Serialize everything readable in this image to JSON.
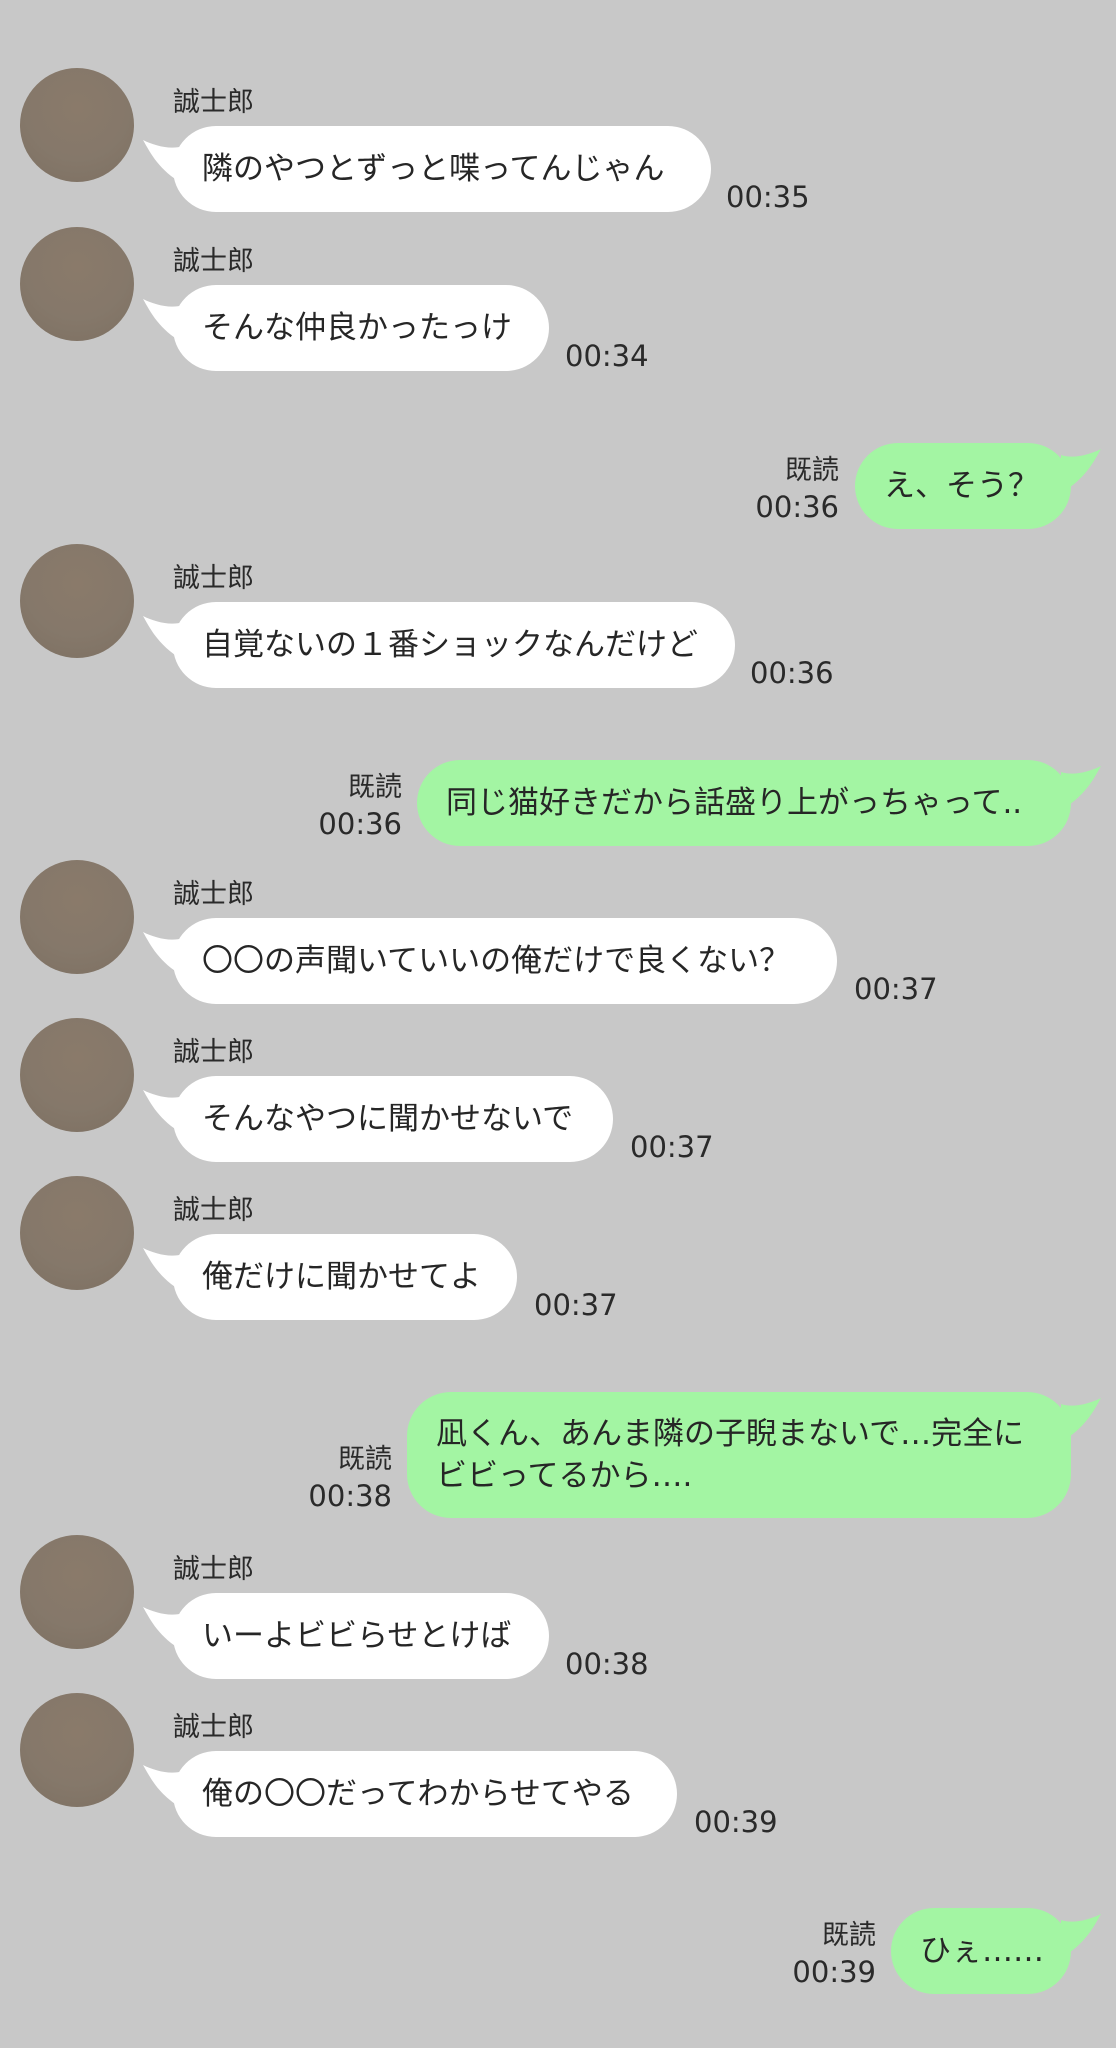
{
  "chat": {
    "read_label": "既読",
    "colors": {
      "background": "#c8c8c8",
      "incoming_bubble": "#ffffff",
      "outgoing_bubble": "#a3f5a3"
    },
    "messages": [
      {
        "direction": "in",
        "sender": "誠士郎",
        "text": "隣のやつとずっと喋ってんじゃん",
        "time": "00:35"
      },
      {
        "direction": "in",
        "sender": "誠士郎",
        "text": "そんな仲良かったっけ",
        "time": "00:34"
      },
      {
        "direction": "out",
        "status": "既読",
        "text": "え、そう？",
        "time": "00:36"
      },
      {
        "direction": "in",
        "sender": "誠士郎",
        "text": "自覚ないの１番ショックなんだけど",
        "time": "00:36"
      },
      {
        "direction": "out",
        "status": "既読",
        "text": "同じ猫好きだから話盛り上がっちゃって..",
        "time": "00:36"
      },
      {
        "direction": "in",
        "sender": "誠士郎",
        "text": "〇〇の声聞いていいの俺だけで良くない？",
        "time": "00:37"
      },
      {
        "direction": "in",
        "sender": "誠士郎",
        "text": "そんなやつに聞かせないで",
        "time": "00:37"
      },
      {
        "direction": "in",
        "sender": "誠士郎",
        "text": "俺だけに聞かせてよ",
        "time": "00:37"
      },
      {
        "direction": "out",
        "status": "既読",
        "text_line1": "凪くん、あんま隣の子睨まないで…完全に",
        "text_line2": "ビビってるから….",
        "time": "00:38"
      },
      {
        "direction": "in",
        "sender": "誠士郎",
        "text": "いーよビビらせとけば",
        "time": "00:38"
      },
      {
        "direction": "in",
        "sender": "誠士郎",
        "text": "俺の〇〇だってわからせてやる",
        "time": "00:39"
      },
      {
        "direction": "out",
        "status": "既読",
        "text": "ひぇ……",
        "time": "00:39"
      }
    ]
  }
}
